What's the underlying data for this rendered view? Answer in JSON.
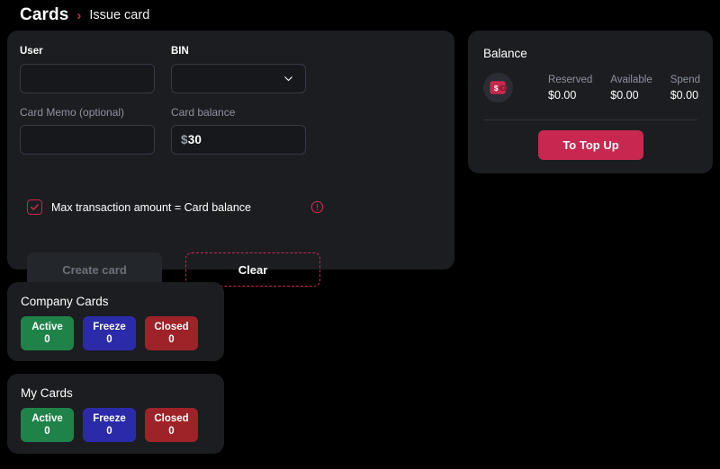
{
  "breadcrumb": {
    "root": "Cards",
    "separator": "›",
    "current": "Issue card"
  },
  "issue_card": {
    "fields": {
      "user": {
        "label": "User",
        "value": "",
        "placeholder": ""
      },
      "bin": {
        "label": "BIN",
        "value": "",
        "chevron_icon": "chevron-down-icon"
      },
      "card_memo": {
        "label": "Card Memo (optional)",
        "value": "",
        "placeholder": ""
      },
      "card_balance": {
        "label": "Card balance",
        "currency": "$",
        "value": "30"
      }
    },
    "checkbox": {
      "label": "Max transaction amount = Card balance",
      "checked": true,
      "check_icon": "check-icon",
      "info_icon": "info-circle-icon"
    },
    "buttons": {
      "create": "Create card",
      "clear": "Clear"
    }
  },
  "balance": {
    "title": "Balance",
    "wallet_icon": "wallet-icon",
    "stats": [
      {
        "label": "Reserved",
        "value": "$0.00"
      },
      {
        "label": "Available",
        "value": "$0.00"
      },
      {
        "label": "Spend",
        "value": "$0.00"
      }
    ],
    "topup_button": "To Top Up"
  },
  "company_cards": {
    "title": "Company Cards",
    "chips": [
      {
        "label": "Active",
        "count": "0",
        "color": "#1f8349"
      },
      {
        "label": "Freeze",
        "count": "0",
        "color": "#2b2baa"
      },
      {
        "label": "Closed",
        "count": "0",
        "color": "#9e2328"
      }
    ]
  },
  "my_cards": {
    "title": "My Cards",
    "chips": [
      {
        "label": "Active",
        "count": "0",
        "color": "#1f8349"
      },
      {
        "label": "Freeze",
        "count": "0",
        "color": "#2b2baa"
      },
      {
        "label": "Closed",
        "count": "0",
        "color": "#9e2328"
      }
    ]
  },
  "theme": {
    "accent": "#c8284f",
    "page_bg": "#000000",
    "panel_bg": "#1b1d21",
    "input_bg": "#16181c",
    "muted_text": "#8e939c"
  }
}
